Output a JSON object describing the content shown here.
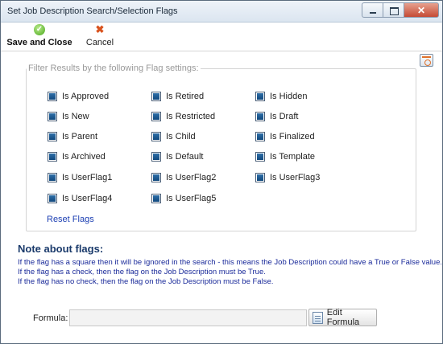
{
  "window": {
    "title": "Set Job Description Search/Selection Flags"
  },
  "toolbar": {
    "save_label": "Save and Close",
    "cancel_label": "Cancel"
  },
  "filter": {
    "legend": "Filter Results by the following Flag settings:",
    "flags": [
      [
        "Is Approved",
        "Is Retired",
        "Is Hidden"
      ],
      [
        "Is New",
        "Is Restricted",
        "Is Draft"
      ],
      [
        "Is Parent",
        "Is Child",
        "Is Finalized"
      ],
      [
        "Is Archived",
        "Is Default",
        "Is Template"
      ],
      [
        "Is UserFlag1",
        "Is UserFlag2",
        "Is UserFlag3"
      ],
      [
        "Is UserFlag4",
        "Is UserFlag5"
      ]
    ],
    "flag_state": "indeterminate",
    "reset_label": "Reset Flags"
  },
  "note": {
    "title": "Note about flags:",
    "lines": [
      "If the flag has a square then it will be ignored in the search - this means the Job Description could have a True or False value.",
      "If the flag has a check, then the flag on the Job Description must be True.",
      "If the flag has no check, then the flag on the Job Description must be False."
    ]
  },
  "formula": {
    "label": "Formula:",
    "value": "",
    "button_label": "Edit Formula"
  }
}
